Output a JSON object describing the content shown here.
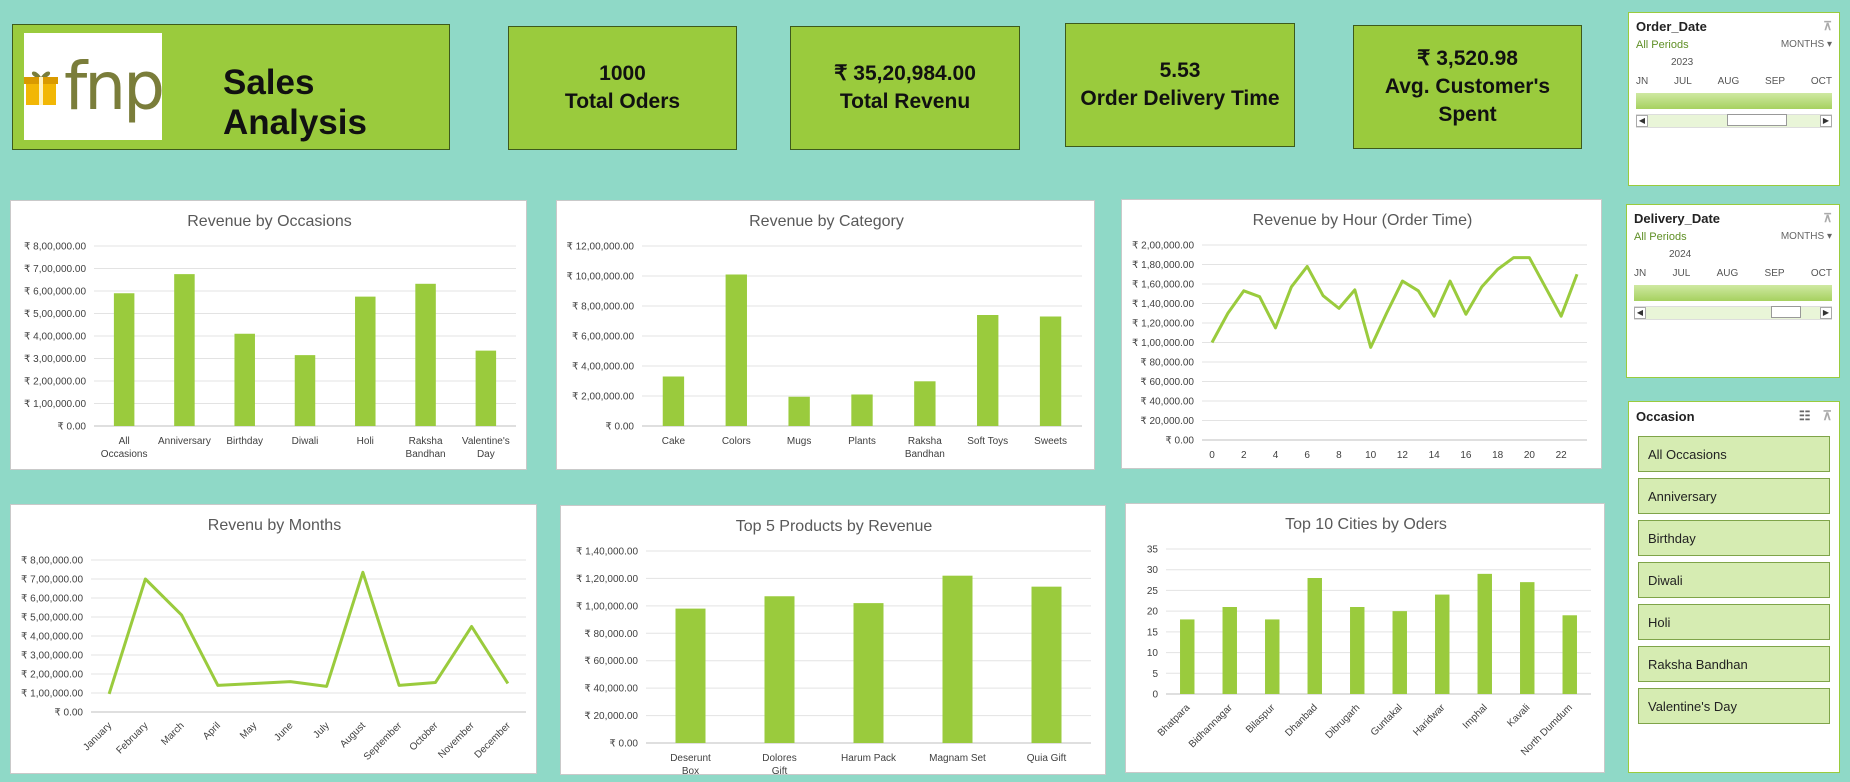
{
  "header": {
    "logo_text": "fnp",
    "title": "Sales Analysis"
  },
  "kpis": [
    {
      "value": "1000",
      "label": "Total Oders"
    },
    {
      "value": "₹ 35,20,984.00",
      "label": "Total Revenu"
    },
    {
      "value": "5.53",
      "label": "Order Delivery Time"
    },
    {
      "value": "₹ 3,520.98",
      "label": "Avg. Customer's Spent"
    }
  ],
  "slicers": {
    "order_date": {
      "title": "Order_Date",
      "period": "All Periods",
      "unit": "MONTHS",
      "year": "2023",
      "months": [
        "JN",
        "JUL",
        "AUG",
        "SEP",
        "OCT"
      ]
    },
    "delivery_date": {
      "title": "Delivery_Date",
      "period": "All Periods",
      "unit": "MONTHS",
      "year": "2024",
      "months": [
        "JN",
        "JUL",
        "AUG",
        "SEP",
        "OCT"
      ]
    },
    "occasion": {
      "title": "Occasion",
      "items": [
        "All Occasions",
        "Anniversary",
        "Birthday",
        "Diwali",
        "Holi",
        "Raksha Bandhan",
        "Valentine's Day"
      ]
    }
  },
  "colors": {
    "bg": "#8fd9c7",
    "accent": "#9acb3d",
    "slicer_item": "#d6ecb2"
  },
  "icons": {
    "filter": "clear-filter-icon",
    "multiselect": "multi-select-icon"
  },
  "chart_data": [
    {
      "type": "bar",
      "title": "Revenue by Occasions",
      "categories": [
        "All Occasions",
        "Anniversary",
        "Birthday",
        "Diwali",
        "Holi",
        "Raksha Bandhan",
        "Valentine's Day"
      ],
      "values": [
        590000,
        675000,
        410000,
        315000,
        575000,
        632000,
        335000
      ],
      "ylim": [
        0,
        800000
      ],
      "yticks": [
        "₹ 0.00",
        "₹ 1,00,000.00",
        "₹ 2,00,000.00",
        "₹ 3,00,000.00",
        "₹ 4,00,000.00",
        "₹ 5,00,000.00",
        "₹ 6,00,000.00",
        "₹ 7,00,000.00",
        "₹ 8,00,000.00"
      ],
      "grid": true
    },
    {
      "type": "bar",
      "title": "Revenue by Category",
      "categories": [
        "Cake",
        "Colors",
        "Mugs",
        "Plants",
        "Raksha Bandhan",
        "Soft Toys",
        "Sweets"
      ],
      "values": [
        330000,
        1010000,
        195000,
        210000,
        298000,
        740000,
        730000
      ],
      "ylim": [
        0,
        1200000
      ],
      "yticks": [
        "₹ 0.00",
        "₹ 2,00,000.00",
        "₹ 4,00,000.00",
        "₹ 6,00,000.00",
        "₹ 8,00,000.00",
        "₹ 10,00,000.00",
        "₹ 12,00,000.00"
      ],
      "grid": true
    },
    {
      "type": "line",
      "title": "Revenue by Hour (Order Time)",
      "x": [
        0,
        1,
        2,
        3,
        4,
        5,
        6,
        7,
        8,
        9,
        10,
        11,
        12,
        13,
        14,
        15,
        16,
        17,
        18,
        19,
        20,
        21,
        22,
        23
      ],
      "values": [
        100000,
        130000,
        153000,
        147000,
        115000,
        157000,
        178000,
        148000,
        135000,
        154000,
        95000,
        130000,
        163000,
        153000,
        127000,
        163000,
        129000,
        157000,
        175000,
        187000,
        187000,
        157000,
        127000,
        170000
      ],
      "xticks": [
        "0",
        "2",
        "4",
        "6",
        "8",
        "10",
        "12",
        "14",
        "16",
        "18",
        "20",
        "22"
      ],
      "ylim": [
        0,
        200000
      ],
      "yticks": [
        "₹ 0.00",
        "₹ 20,000.00",
        "₹ 40,000.00",
        "₹ 60,000.00",
        "₹ 80,000.00",
        "₹ 1,00,000.00",
        "₹ 1,20,000.00",
        "₹ 1,40,000.00",
        "₹ 1,60,000.00",
        "₹ 1,80,000.00",
        "₹ 2,00,000.00"
      ],
      "grid": true
    },
    {
      "type": "line",
      "title": "Revenu by Months",
      "categories": [
        "January",
        "February",
        "March",
        "April",
        "May",
        "June",
        "July",
        "August",
        "September",
        "October",
        "November",
        "December"
      ],
      "values": [
        95000,
        700000,
        510000,
        140000,
        150000,
        160000,
        135000,
        735000,
        140000,
        155000,
        450000,
        150000
      ],
      "ylim": [
        0,
        800000
      ],
      "yticks": [
        "₹ 0.00",
        "₹ 1,00,000.00",
        "₹ 2,00,000.00",
        "₹ 3,00,000.00",
        "₹ 4,00,000.00",
        "₹ 5,00,000.00",
        "₹ 6,00,000.00",
        "₹ 7,00,000.00",
        "₹ 8,00,000.00"
      ],
      "grid": true
    },
    {
      "type": "bar",
      "title": "Top 5 Products by Revenue",
      "categories": [
        "Deserunt Box",
        "Dolores Gift",
        "Harum Pack",
        "Magnam Set",
        "Quia Gift"
      ],
      "values": [
        98000,
        107000,
        102000,
        122000,
        114000
      ],
      "ylim": [
        0,
        140000
      ],
      "yticks": [
        "₹ 0.00",
        "₹ 20,000.00",
        "₹ 40,000.00",
        "₹ 60,000.00",
        "₹ 80,000.00",
        "₹ 1,00,000.00",
        "₹ 1,20,000.00",
        "₹ 1,40,000.00"
      ],
      "grid": true
    },
    {
      "type": "bar",
      "title": "Top 10 Cities by Oders",
      "categories": [
        "Bhatpara",
        "Bidhannagar",
        "Bilaspur",
        "Dhanbad",
        "Dibrugarh",
        "Guntakal",
        "Haridwar",
        "Imphal",
        "Kavali",
        "North Dumdum"
      ],
      "values": [
        18,
        21,
        18,
        28,
        21,
        20,
        24,
        29,
        27,
        19
      ],
      "ylim": [
        0,
        35
      ],
      "yticks": [
        "0",
        "5",
        "10",
        "15",
        "20",
        "25",
        "30",
        "35"
      ],
      "grid": true
    }
  ]
}
